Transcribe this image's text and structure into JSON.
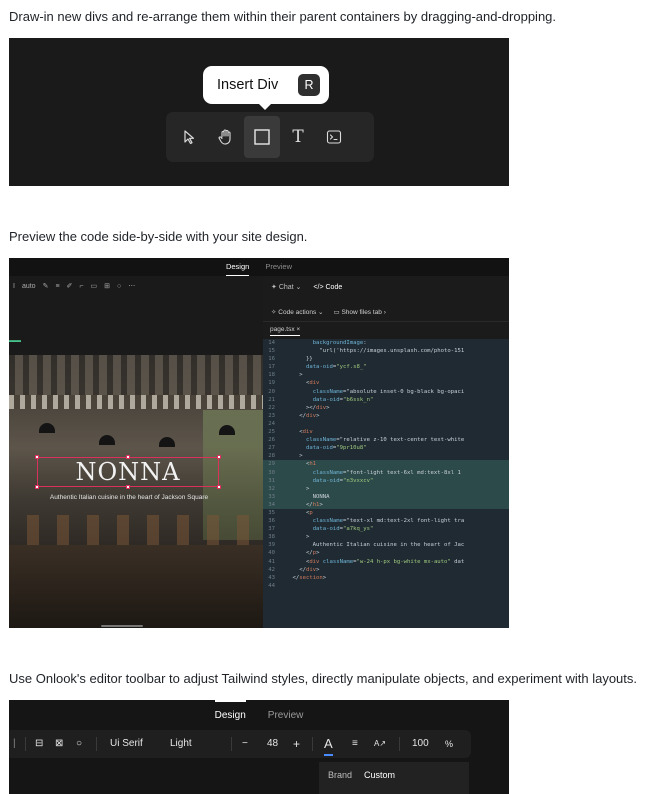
{
  "sections": [
    {
      "caption": "Draw-in new divs and re-arrange them within their parent containers by dragging-and-dropping."
    },
    {
      "caption": "Preview the code side-by-side with your site design."
    },
    {
      "caption": "Use Onlook's editor toolbar to adjust Tailwind styles, directly manipulate objects, and experiment with layouts."
    }
  ],
  "panel1": {
    "tooltip_label": "Insert Div",
    "tooltip_shortcut": "R",
    "tools": [
      "cursor-icon",
      "hand-icon",
      "square-icon",
      "text-icon",
      "terminal-icon"
    ],
    "text_tool_glyph": "T"
  },
  "panel2": {
    "tabs": [
      "Design",
      "Preview"
    ],
    "toolbar_auto": "auto",
    "site_title": "NONNA",
    "site_tagline": "Authentic Italian cuisine in the heart of Jackson Square",
    "chat_tab": "Chat",
    "code_tab": "Code",
    "code_actions": "Code actions",
    "show_files_tab": "Show files tab",
    "file_tab": "page.tsx",
    "code_lines": [
      {
        "n": "14",
        "t": "          backgroundImage:",
        "hl": false
      },
      {
        "n": "15",
        "t": "            \"url('https://images.unsplash.com/photo-151",
        "hl": false
      },
      {
        "n": "16",
        "t": "        }}",
        "hl": false
      },
      {
        "n": "17",
        "t": "        data-oid=\"ycf.s8_\"",
        "hl": false
      },
      {
        "n": "18",
        "t": "      >",
        "hl": false
      },
      {
        "n": "19",
        "t": "        <div",
        "hl": false
      },
      {
        "n": "20",
        "t": "          className=\"absolute inset-0 bg-black bg-opaci",
        "hl": false
      },
      {
        "n": "21",
        "t": "          data-oid=\"b6ssk_n\"",
        "hl": false
      },
      {
        "n": "22",
        "t": "        ></div>",
        "hl": false
      },
      {
        "n": "23",
        "t": "      </div>",
        "hl": false
      },
      {
        "n": "24",
        "t": "",
        "hl": false
      },
      {
        "n": "25",
        "t": "      <div",
        "hl": false
      },
      {
        "n": "26",
        "t": "        className=\"relative z-10 text-center text-white",
        "hl": false
      },
      {
        "n": "27",
        "t": "        data-oid=\"9pr10u8\"",
        "hl": false
      },
      {
        "n": "28",
        "t": "      >",
        "hl": false
      },
      {
        "n": "29",
        "t": "        <h1",
        "hl": true
      },
      {
        "n": "30",
        "t": "          className=\"font-light text-6xl md:text-8xl 1",
        "hl": true
      },
      {
        "n": "31",
        "t": "          data-oid=\"n3vxxcv\"",
        "hl": true
      },
      {
        "n": "32",
        "t": "        >",
        "hl": true
      },
      {
        "n": "33",
        "t": "          NONNA",
        "hl": true
      },
      {
        "n": "34",
        "t": "        </h1>",
        "hl": true
      },
      {
        "n": "35",
        "t": "        <p",
        "hl": false
      },
      {
        "n": "36",
        "t": "          className=\"text-xl md:text-2xl font-light tra",
        "hl": false
      },
      {
        "n": "37",
        "t": "          data-oid=\"a7kq_ys\"",
        "hl": false
      },
      {
        "n": "38",
        "t": "        >",
        "hl": false
      },
      {
        "n": "39",
        "t": "          Authentic Italian cuisine in the heart of Jac",
        "hl": false
      },
      {
        "n": "40",
        "t": "        </p>",
        "hl": false
      },
      {
        "n": "41",
        "t": "        <div className=\"w-24 h-px bg-white mx-auto\" dat",
        "hl": false
      },
      {
        "n": "42",
        "t": "      </div>",
        "hl": false
      },
      {
        "n": "43",
        "t": "    </section>",
        "hl": false
      },
      {
        "n": "44",
        "t": "",
        "hl": false
      }
    ]
  },
  "panel3": {
    "tabs": [
      "Design",
      "Preview"
    ],
    "font_family": "Ui Serif",
    "font_weight": "Light",
    "font_size": "48",
    "minus": "−",
    "plus": "+",
    "text_color_glyph": "A",
    "zoom": "100",
    "percent": "%",
    "dropdown_tabs": [
      "Brand",
      "Custom"
    ]
  },
  "colors": {
    "selection": "#d9315c",
    "code_highlight": "#2d4a4a",
    "accent_blue": "#4a8cff"
  }
}
